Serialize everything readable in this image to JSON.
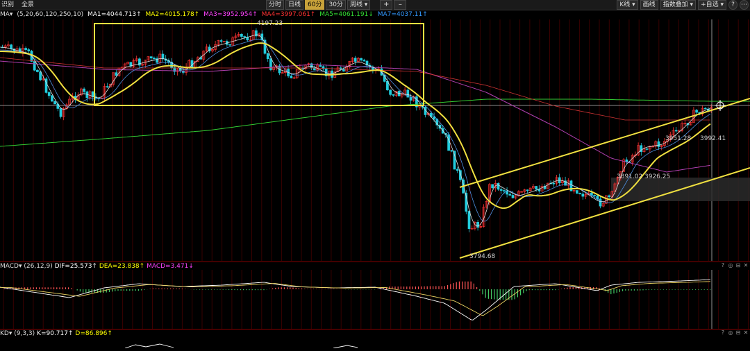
{
  "toolbar": {
    "left_items": [
      "识别",
      "全景"
    ],
    "periods": [
      {
        "label": "分时",
        "active": false
      },
      {
        "label": "日线",
        "active": false
      },
      {
        "label": "60分",
        "active": true
      },
      {
        "label": "30分",
        "active": false
      },
      {
        "label": "周线 ▾",
        "active": false
      }
    ],
    "controls": [
      "+",
      "–"
    ],
    "right_items": [
      "K线 ▾",
      "画线",
      "指数叠加 ▾",
      "+自选 ▾"
    ],
    "right_icons": [
      "?",
      "⋯"
    ]
  },
  "ma_bar": {
    "label": "MA▾",
    "params": "(5,20,60,120,250,10)",
    "items": [
      {
        "text": "MA1=4044.713↑",
        "color": "#ffffff"
      },
      {
        "text": "MA2=4015.178↑",
        "color": "#ffff00"
      },
      {
        "text": "MA3=3952.954↑",
        "color": "#ff44ff"
      },
      {
        "text": "MA4=3997.061↑",
        "color": "#ff3333"
      },
      {
        "text": "MA5=4061.191↓",
        "color": "#33dd33"
      },
      {
        "text": "MA7=4037.11↑",
        "color": "#3399ff"
      }
    ]
  },
  "annotations": {
    "high": "4197.23",
    "low": "3794.68",
    "box_a": "3891.02",
    "box_b": "3926.25",
    "box_c": "3951.28",
    "box_d": "3992.41"
  },
  "macd_bar": {
    "label": "MACD▾",
    "params": "(26,12,9)",
    "dif": "DIF=25.573↑",
    "dea": "DEA=23.838↑",
    "macd": "MACD=3.471↓"
  },
  "kd_bar": {
    "label": "KD▾",
    "params": "(9,3,3)",
    "k": "K=90.717↑",
    "d": "D=86.896↑"
  },
  "panel_icons": [
    "?",
    "◎",
    "⊟",
    "✕"
  ],
  "colors": {
    "up": "#ff3333",
    "down": "#22ccdd",
    "accent": "#c8a23a",
    "divider": "#8b0000"
  }
}
